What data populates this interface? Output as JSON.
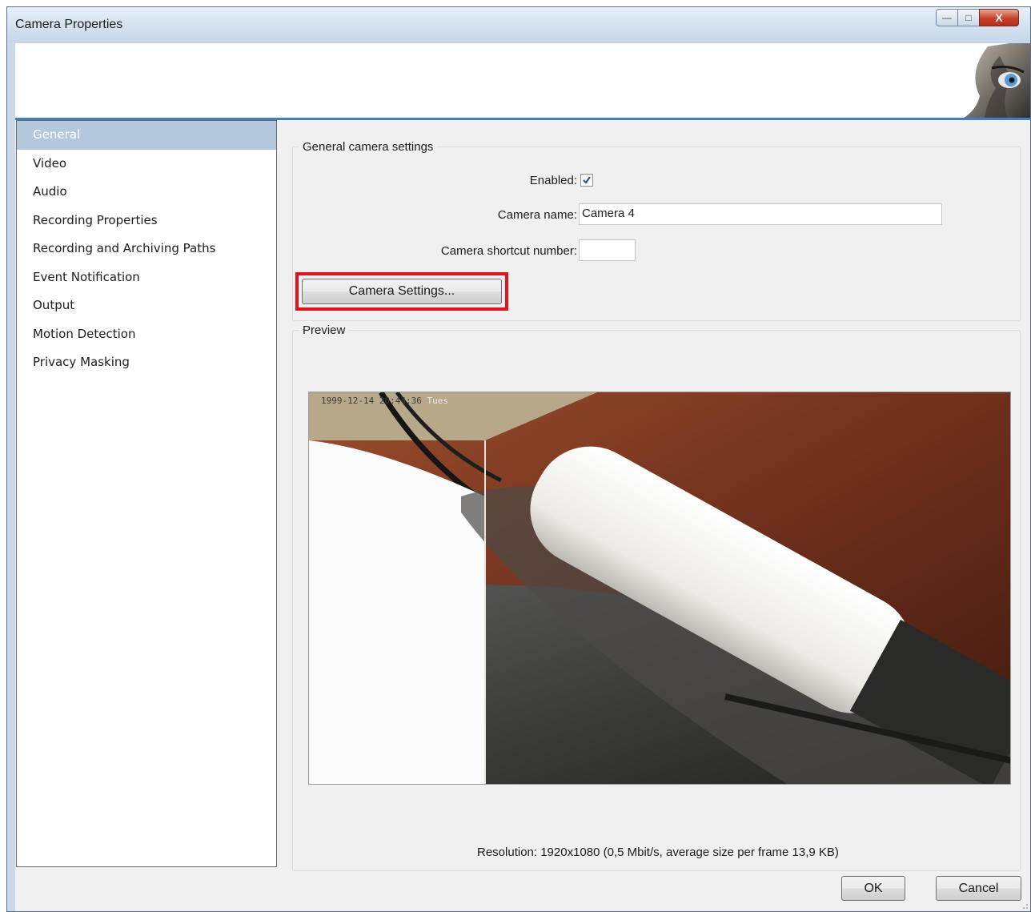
{
  "window": {
    "title": "Camera Properties",
    "caption_buttons": {
      "minimize_glyph": "—",
      "maximize_glyph": "□",
      "close_glyph": "X"
    }
  },
  "sidebar": {
    "items": [
      {
        "label": "General",
        "selected": true
      },
      {
        "label": "Video",
        "selected": false
      },
      {
        "label": "Audio",
        "selected": false
      },
      {
        "label": "Recording Properties",
        "selected": false
      },
      {
        "label": "Recording and Archiving Paths",
        "selected": false
      },
      {
        "label": "Event Notification",
        "selected": false
      },
      {
        "label": "Output",
        "selected": false
      },
      {
        "label": "Motion Detection",
        "selected": false
      },
      {
        "label": "Privacy Masking",
        "selected": false
      }
    ]
  },
  "general_settings": {
    "group_label": "General camera settings",
    "enabled_label": "Enabled:",
    "enabled_checked": true,
    "camera_name_label": "Camera name:",
    "camera_name_value": "Camera 4",
    "shortcut_label": "Camera shortcut number:",
    "shortcut_value": "",
    "camera_settings_button": "Camera Settings..."
  },
  "preview": {
    "group_label": "Preview",
    "osd_timestamp": "1999-12-14 20:44:36",
    "osd_day": "Tues",
    "resolution_text": "Resolution:  1920x1080  (0,5 Mbit/s, average size per frame 13,9 KB)"
  },
  "footer": {
    "ok_label": "OK",
    "cancel_label": "Cancel"
  },
  "colors": {
    "highlight": "#e0141e",
    "banner_accent": "#3d7fc6",
    "selected_item_bg": "#b4c8dd"
  }
}
